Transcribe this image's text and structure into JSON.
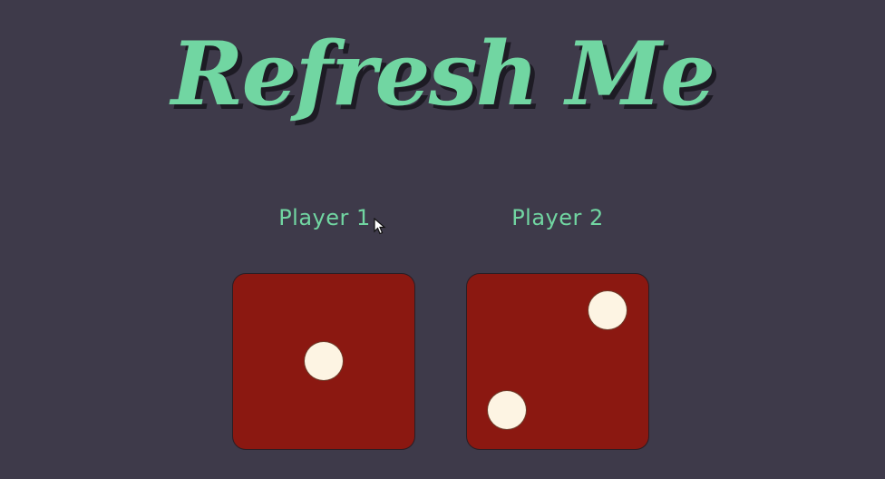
{
  "page": {
    "title": "Refresh Me"
  },
  "players": [
    {
      "label": "Player 1",
      "die_value": 1
    },
    {
      "label": "Player 2",
      "die_value": 2
    }
  ],
  "colors": {
    "background": "#3e3a4a",
    "accent": "#71d6a2",
    "die": "#8b1811",
    "pip": "#fdf4e3"
  },
  "icons": {
    "cursor": "mouse-pointer-icon"
  }
}
